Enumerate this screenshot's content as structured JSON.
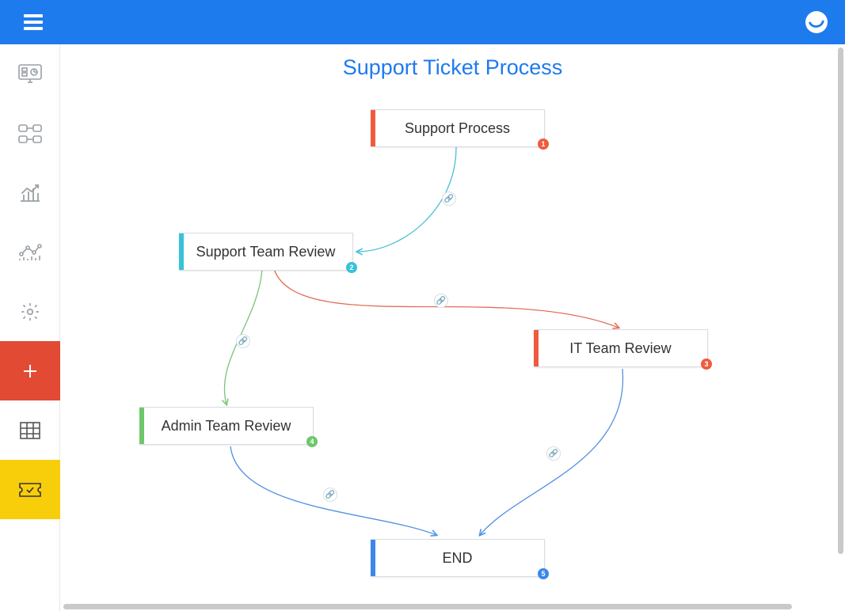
{
  "page": {
    "title": "Support Ticket Process"
  },
  "sidebar": {
    "items": [
      {
        "name": "dashboard-icon"
      },
      {
        "name": "relations-icon"
      },
      {
        "name": "reports-icon"
      },
      {
        "name": "analytics-icon"
      },
      {
        "name": "settings-icon"
      },
      {
        "name": "add-button"
      },
      {
        "name": "grid-icon"
      },
      {
        "name": "ticket-icon"
      }
    ]
  },
  "nodes": {
    "n1": {
      "label": "Support Process",
      "badge": "1",
      "accent": "#f05b3f"
    },
    "n2": {
      "label": "Support Team Review",
      "badge": "2",
      "accent": "#37c2d9"
    },
    "n3": {
      "label": "IT Team Review",
      "badge": "3",
      "accent": "#f05b3f"
    },
    "n4": {
      "label": "Admin Team Review",
      "badge": "4",
      "accent": "#6fc66b"
    },
    "n5": {
      "label": "END",
      "badge": "5",
      "accent": "#3b87ea"
    }
  },
  "connectors": [
    {
      "from": "n1",
      "to": "n2",
      "color": "#37c2d9"
    },
    {
      "from": "n2",
      "to": "n3",
      "color": "#f05b3f"
    },
    {
      "from": "n2",
      "to": "n4",
      "color": "#6fc66b"
    },
    {
      "from": "n3",
      "to": "n5",
      "color": "#3b87ea"
    },
    {
      "from": "n4",
      "to": "n5",
      "color": "#3b87ea"
    }
  ]
}
